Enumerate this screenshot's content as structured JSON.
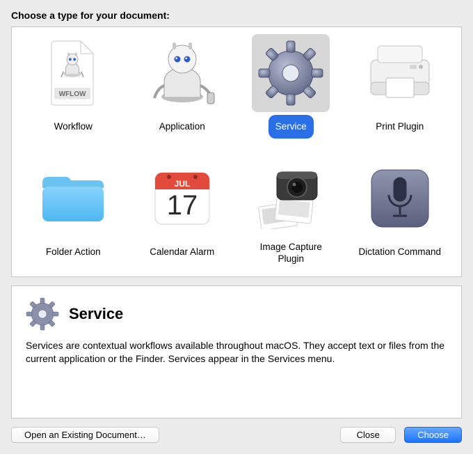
{
  "header": {
    "title": "Choose a type for your document:"
  },
  "grid": {
    "items": [
      {
        "id": "workflow",
        "label": "Workflow",
        "icon": "workflow-icon"
      },
      {
        "id": "application",
        "label": "Application",
        "icon": "application-icon"
      },
      {
        "id": "service",
        "label": "Service",
        "icon": "service-icon",
        "selected": true
      },
      {
        "id": "print-plugin",
        "label": "Print Plugin",
        "icon": "print-plugin-icon"
      },
      {
        "id": "folder-action",
        "label": "Folder Action",
        "icon": "folder-action-icon"
      },
      {
        "id": "calendar-alarm",
        "label": "Calendar Alarm",
        "icon": "calendar-alarm-icon"
      },
      {
        "id": "image-capture",
        "label": "Image Capture Plugin",
        "icon": "image-capture-icon"
      },
      {
        "id": "dictation",
        "label": "Dictation Command",
        "icon": "dictation-icon"
      }
    ]
  },
  "desc": {
    "icon": "service-icon",
    "title": "Service",
    "text": "Services are contextual workflows available throughout macOS. They accept text or files from the current application or the Finder. Services appear in the Services menu."
  },
  "calendar": {
    "month": "JUL",
    "day": "17"
  },
  "workflow_doc": {
    "ext": "WFLOW"
  },
  "buttons": {
    "open": "Open an Existing Document…",
    "close": "Close",
    "choose": "Choose"
  }
}
